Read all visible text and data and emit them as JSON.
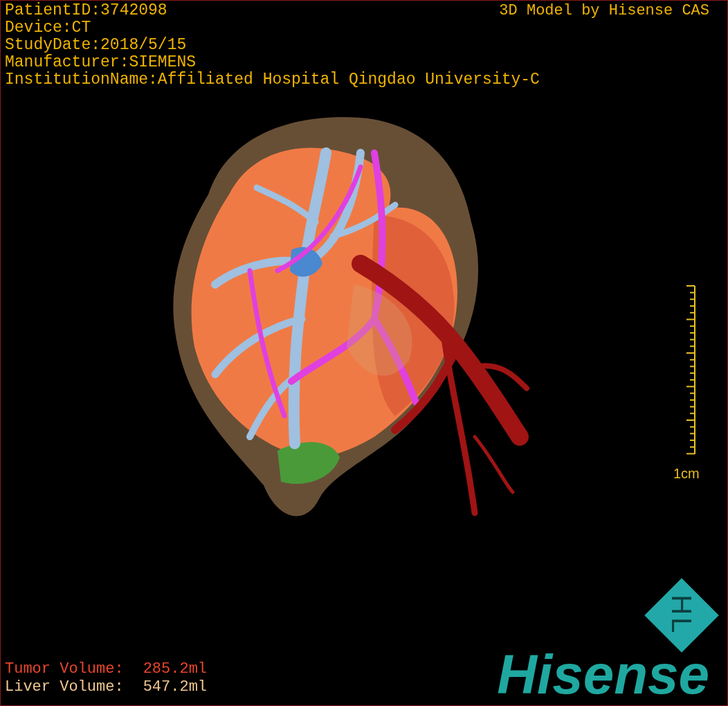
{
  "study_info": [
    "PatientID:3742098",
    "Device:CT",
    "StudyDate:2018/5/15",
    "Manufacturer:SIEMENS",
    "InstitutionName:Affiliated Hospital Qingdao University-C"
  ],
  "title": "3D Model by Hisense CAS",
  "scale_bar": {
    "label": "1cm"
  },
  "volumes": [
    {
      "kind": "tumor",
      "label": "Tumor Volume:",
      "value": "285.2ml"
    },
    {
      "kind": "liver",
      "label": "Liver Volume:",
      "value": "547.2ml"
    }
  ],
  "logo": {
    "mark": "HL",
    "wordmark": "Hisense"
  }
}
